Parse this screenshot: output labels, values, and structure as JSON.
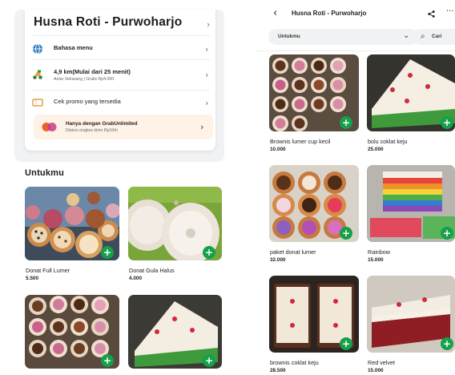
{
  "store": {
    "name": "Husna Roti - Purwoharjo",
    "language_menu": "Bahasa menu",
    "delivery_info": "4,9 km(Mulai dari 25 menit)",
    "delivery_sub": "Antar Sekarang | Gratis Rp4.000",
    "promo_check": "Cek promo yang tersedia",
    "grab_unlimited_title": "Hanya dengan GrabUnlimited",
    "grab_unlimited_sub": "Diskon ongkos kirim Rp10rb"
  },
  "section": {
    "title": "Untukmu"
  },
  "left_items": [
    {
      "name": "Donat Full Lumer",
      "price": "5.500"
    },
    {
      "name": "Donat Gula Halus",
      "price": "4.000"
    }
  ],
  "header": {
    "title": "Husna Roti - Purwoharjo",
    "back_icon": "‹",
    "share_icon": "share-icon",
    "more_icon": "···",
    "category": "Untukmu",
    "search_label": "Cari"
  },
  "right_items": [
    {
      "name": "Brownis lumer cup kecil",
      "price": "10.000"
    },
    {
      "name": "bolu coklat keju",
      "price": "25.000"
    },
    {
      "name": "paket donat lumer",
      "price": "32.000"
    },
    {
      "name": "Rainbow",
      "price": "15.000"
    },
    {
      "name": "brownis coklat keju",
      "price": "28.500"
    },
    {
      "name": "Red velvet",
      "price": "15.000"
    }
  ],
  "colors": {
    "accent_green": "#15a04a",
    "promo_bg": "#fff3e8",
    "grab_unlimited_brand": "#e8622c"
  },
  "add_icon": "+"
}
